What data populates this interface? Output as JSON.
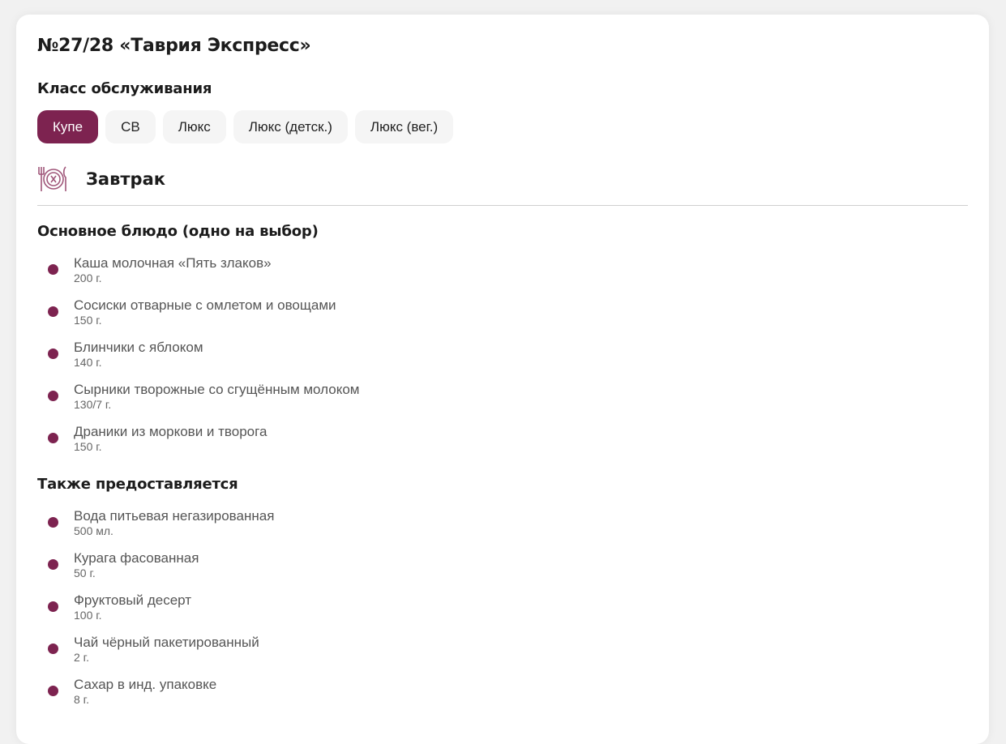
{
  "title": "№27/28 «Таврия Экспресс»",
  "class_heading": "Класс обслуживания",
  "classes": [
    "Купе",
    "СВ",
    "Люкс",
    "Люкс (детск.)",
    "Люкс (вег.)"
  ],
  "active_class": "Купе",
  "meal": {
    "icon": "plate-cutlery-icon",
    "title": "Завтрак"
  },
  "sections": [
    {
      "heading": "Основное блюдо (одно на выбор)",
      "items": [
        {
          "name": "Каша молочная «Пять злаков»",
          "weight": "200 г."
        },
        {
          "name": "Сосиски отварные с омлетом и овощами",
          "weight": "150 г."
        },
        {
          "name": "Блинчики с яблоком",
          "weight": "140 г."
        },
        {
          "name": "Сырники творожные со сгущённым молоком",
          "weight": "130/7 г."
        },
        {
          "name": "Драники из моркови и творога",
          "weight": "150 г."
        }
      ]
    },
    {
      "heading": "Также предоставляется",
      "items": [
        {
          "name": "Вода питьевая негазированная",
          "weight": "500 мл."
        },
        {
          "name": "Курага фасованная",
          "weight": "50 г."
        },
        {
          "name": "Фруктовый десерт",
          "weight": "100 г."
        },
        {
          "name": "Чай чёрный пакетированный",
          "weight": "2 г."
        },
        {
          "name": "Сахар в инд. упаковке",
          "weight": "8 г."
        }
      ]
    }
  ],
  "colors": {
    "accent": "#7d2350"
  }
}
